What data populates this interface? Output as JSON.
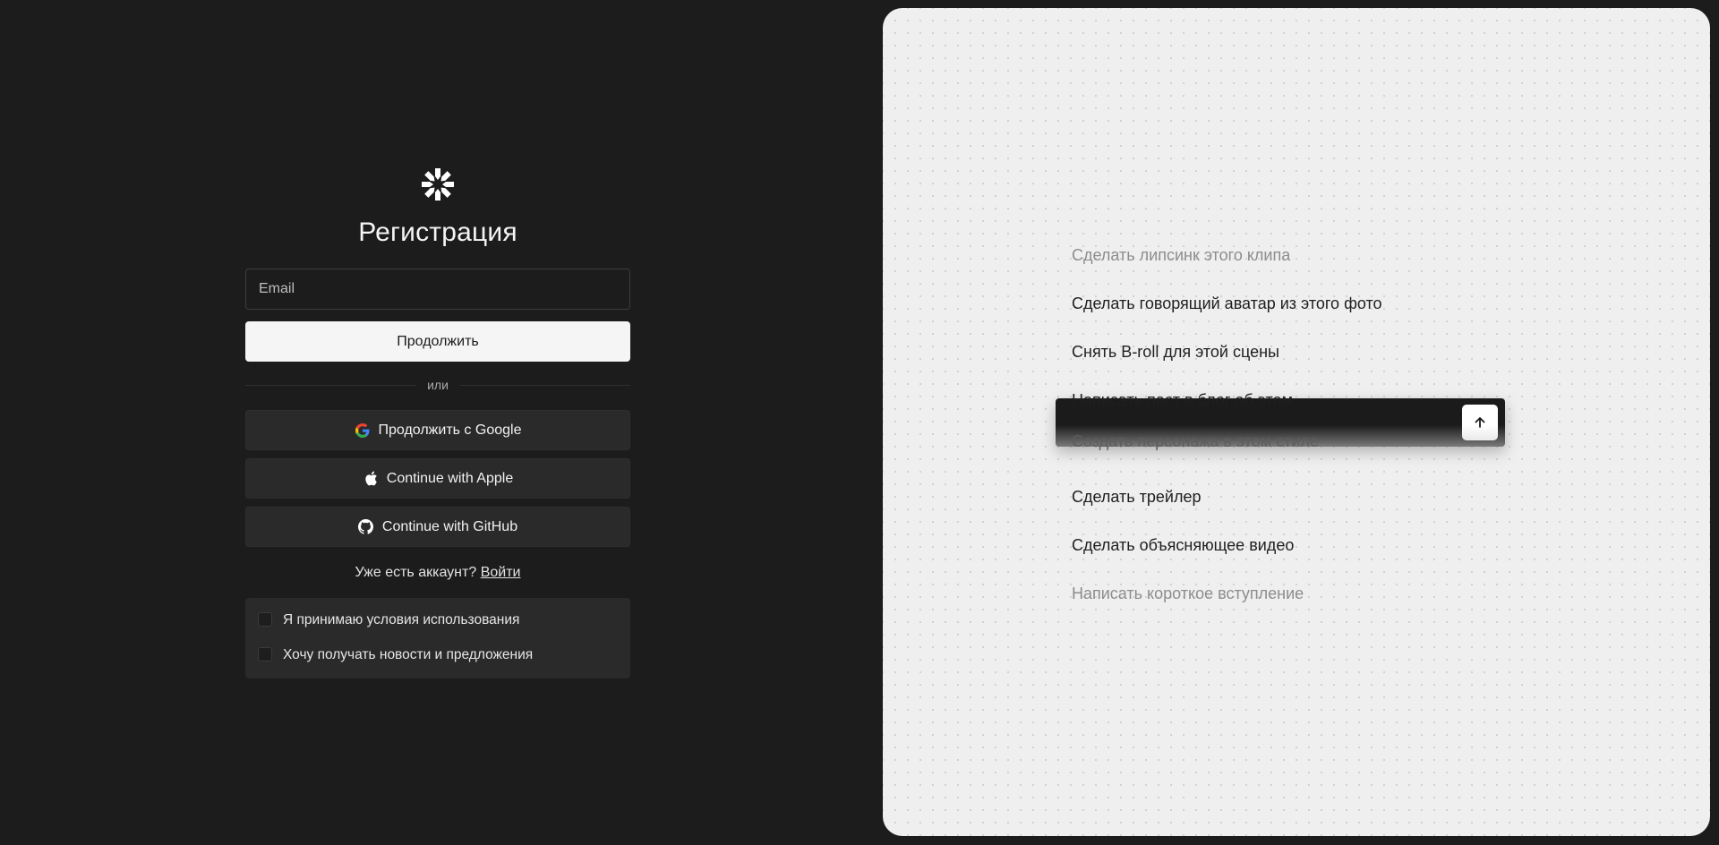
{
  "signup": {
    "title": "Регистрация",
    "email_placeholder": "Email",
    "continue_label": "Продолжить",
    "divider_text": "или",
    "google_label": "Продолжить с Google",
    "apple_label": "Continue with Apple",
    "github_label": "Continue with GitHub",
    "have_account_text": "Уже есть аккаунт?",
    "login_link": "Войти",
    "terms_label": "Я принимаю условия использования",
    "news_label": "Хочу получать новости и предложения"
  },
  "showcase": {
    "prompts": [
      {
        "text": "Сделать липсинк этого клипа",
        "faded": true
      },
      {
        "text": "Сделать говорящий аватар из этого фото",
        "faded": false
      },
      {
        "text": "Снять B-roll для этой сцены",
        "faded": false
      },
      {
        "text": "Написать пост в блог об этом",
        "faded": false
      },
      {
        "text": "",
        "faded": false
      },
      {
        "text": "Сделать трейлер",
        "faded": false
      },
      {
        "text": "Сделать объясняющее видео",
        "faded": false
      },
      {
        "text": "Написать короткое вступление",
        "faded": true
      }
    ],
    "active_prompt": "Создать персонажа в этом стиле",
    "send_icon": "arrow-up-icon"
  },
  "colors": {
    "background": "#1c1c1c",
    "panel": "#2a2a2a",
    "showcase_bg": "#efefef",
    "primary_button": "#f5f5f5"
  }
}
